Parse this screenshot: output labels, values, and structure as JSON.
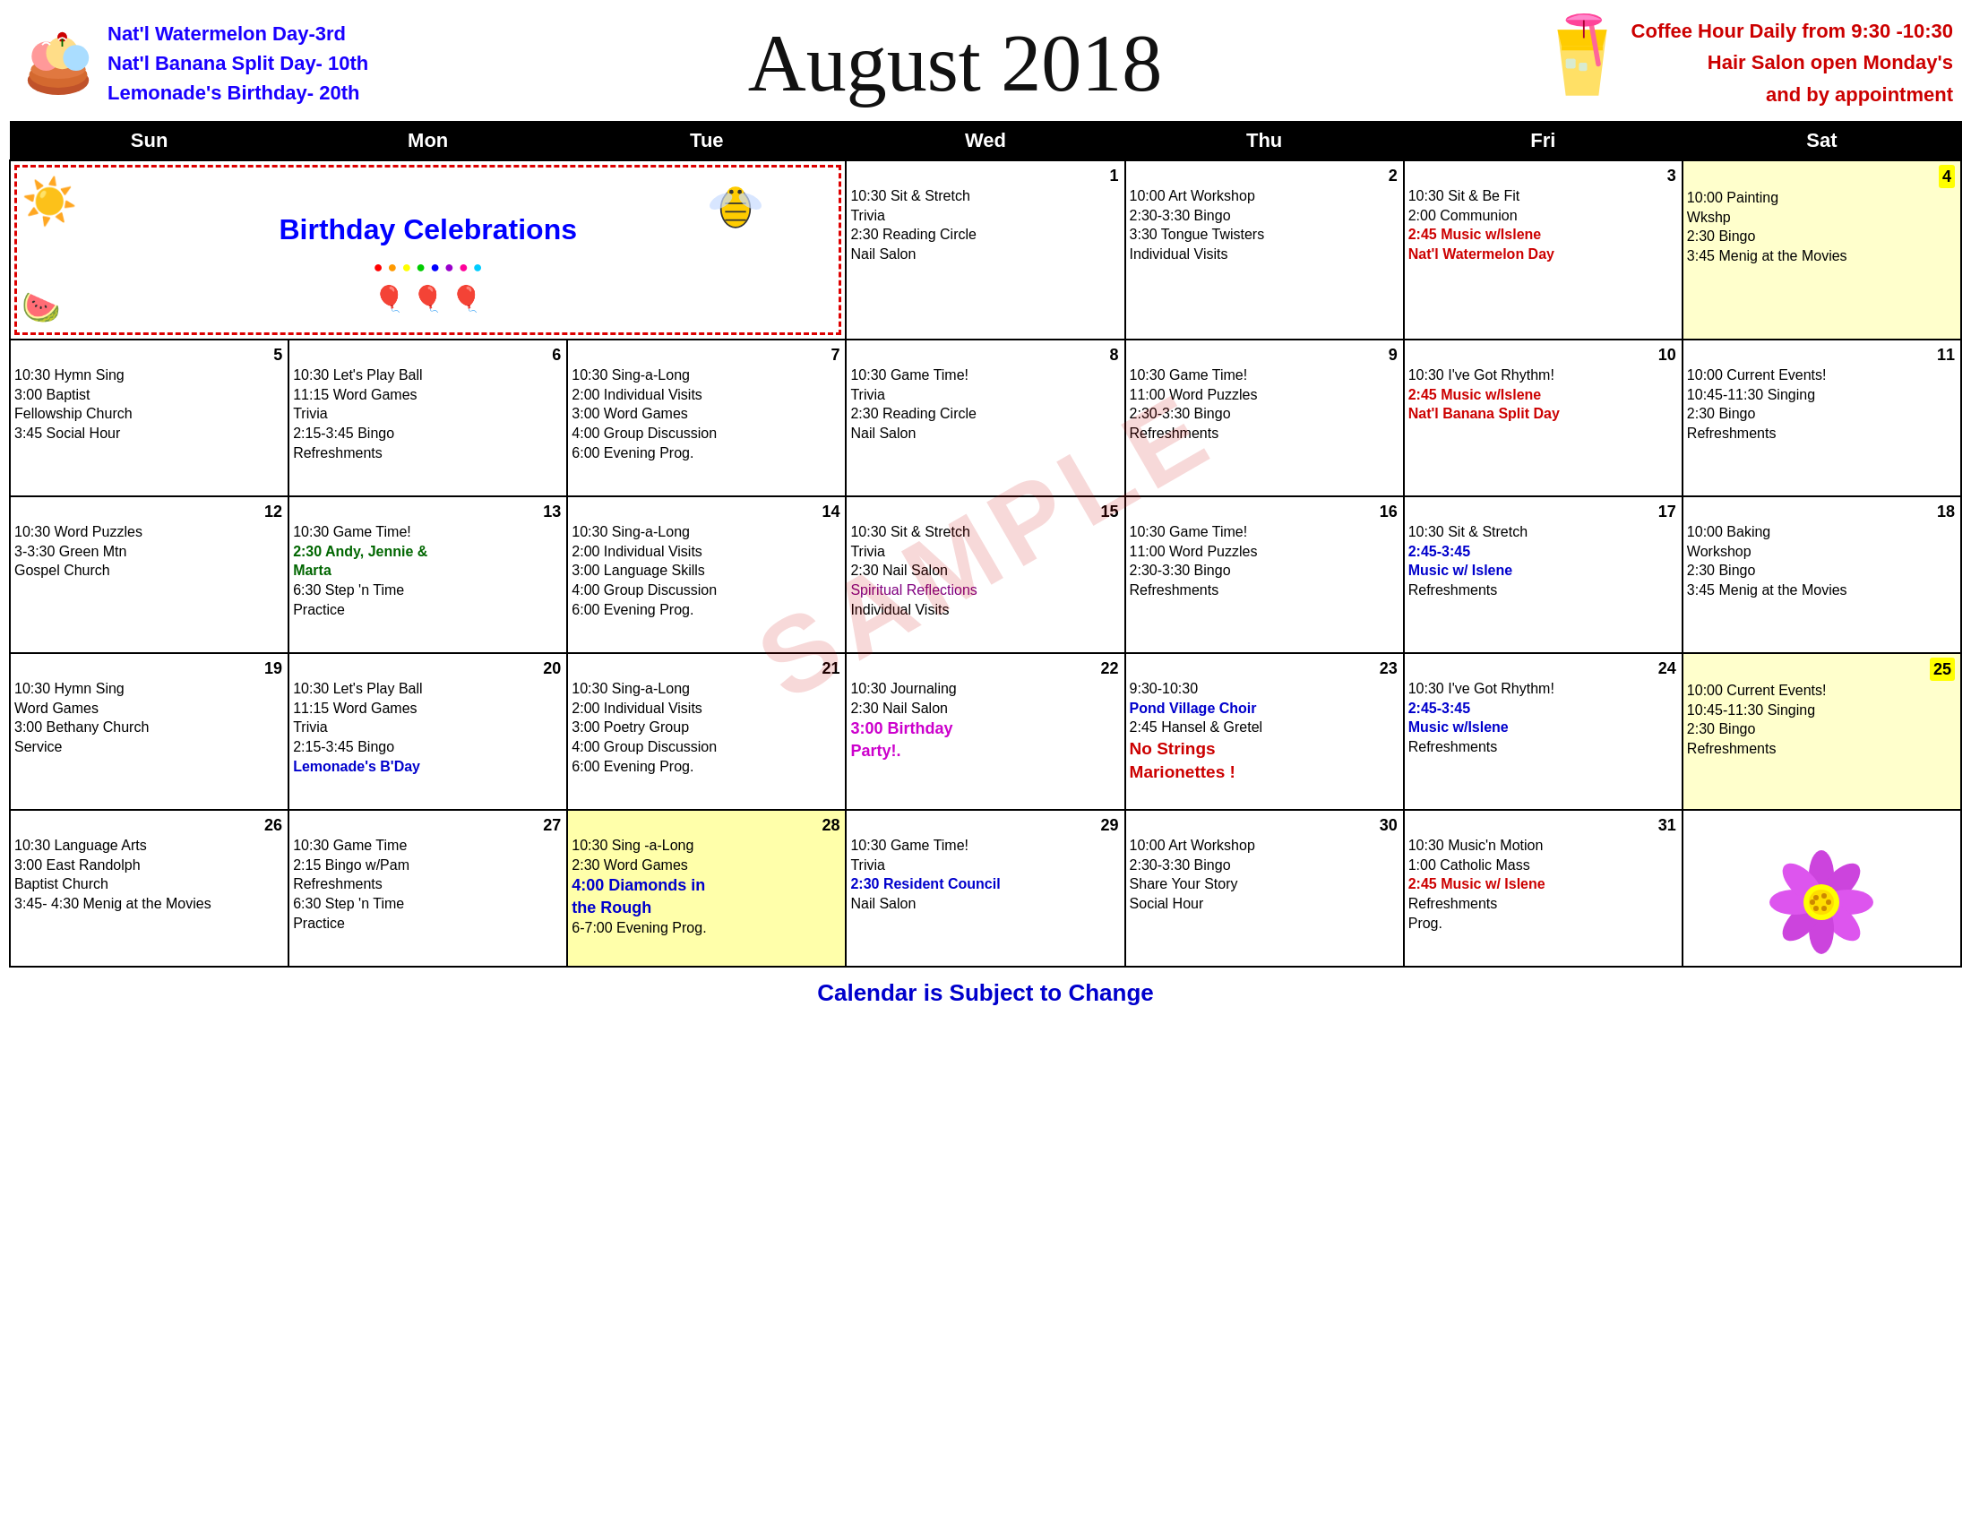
{
  "header": {
    "title": "August 2018",
    "left_notes": [
      "Nat'l Watermelon Day-3rd",
      "Nat'l Banana Split Day- 10th",
      "Lemonade's Birthday- 20th"
    ],
    "right_notes": [
      "Coffee Hour Daily from 9:30 -10:30",
      "Hair Salon open Monday's",
      "and by appointment"
    ]
  },
  "days_of_week": [
    "Sun",
    "Mon",
    "Tue",
    "Wed",
    "Thu",
    "Fri",
    "Sat"
  ],
  "footer": "Calendar is Subject to Change",
  "watermark": "SAMPLE",
  "weeks": [
    {
      "id": "week0-birthday",
      "cells": [
        {
          "span": 3,
          "type": "birthday",
          "content": "Birthday Celebrations"
        },
        {
          "day": 1,
          "events": [
            {
              "text": "10:30 Sit & Stretch",
              "color": "black"
            },
            {
              "text": "Trivia",
              "color": "black"
            },
            {
              "text": "2:30 Reading Circle",
              "color": "black"
            },
            {
              "text": "Nail Salon",
              "color": "black"
            }
          ]
        },
        {
          "day": 2,
          "events": [
            {
              "text": "10:00 Art Workshop",
              "color": "black"
            },
            {
              "text": "2:30-3:30 Bingo",
              "color": "black"
            },
            {
              "text": "3:30 Tongue Twisters",
              "color": "black"
            },
            {
              "text": "Individual Visits",
              "color": "black"
            }
          ]
        },
        {
          "day": 3,
          "events": [
            {
              "text": "10:30 Sit & Be Fit",
              "color": "black"
            },
            {
              "text": "2:00 Communion",
              "color": "black"
            },
            {
              "text": "2:45 Music w/Islene",
              "color": "red",
              "bold": true
            },
            {
              "text": "Nat'l Watermelon Day",
              "color": "red",
              "bold": true
            }
          ]
        },
        {
          "day": 4,
          "dayBg": "yellow",
          "events": [
            {
              "text": "10:00 Painting",
              "color": "black"
            },
            {
              "text": "Wkshp",
              "color": "black"
            },
            {
              "text": "2:30 Bingo",
              "color": "black"
            },
            {
              "text": "3:45 Menig at the Movies",
              "color": "black"
            }
          ]
        }
      ]
    },
    {
      "id": "week1",
      "cells": [
        {
          "day": 5,
          "events": [
            {
              "text": "10:30 Hymn Sing",
              "color": "black"
            },
            {
              "text": "3:00 Baptist",
              "color": "black"
            },
            {
              "text": "Fellowship Church",
              "color": "black"
            },
            {
              "text": "3:45 Social Hour",
              "color": "black"
            }
          ]
        },
        {
          "day": 6,
          "events": [
            {
              "text": "10:30 Let's Play Ball",
              "color": "black"
            },
            {
              "text": "11:15 Word Games",
              "color": "black"
            },
            {
              "text": "Trivia",
              "color": "black"
            },
            {
              "text": "2:15-3:45 Bingo",
              "color": "black"
            },
            {
              "text": "Refreshments",
              "color": "black"
            }
          ]
        },
        {
          "day": 7,
          "events": [
            {
              "text": "10:30 Sing-a-Long",
              "color": "black"
            },
            {
              "text": "2:00 Individual Visits",
              "color": "black"
            },
            {
              "text": "3:00 Word Games",
              "color": "black"
            },
            {
              "text": "4:00 Group Discussion",
              "color": "black"
            },
            {
              "text": "6:00 Evening Prog.",
              "color": "black"
            }
          ]
        },
        {
          "day": 8,
          "events": [
            {
              "text": "10:30 Game Time!",
              "color": "black"
            },
            {
              "text": "Trivia",
              "color": "black"
            },
            {
              "text": "2:30 Reading Circle",
              "color": "black"
            },
            {
              "text": "Nail Salon",
              "color": "black"
            }
          ]
        },
        {
          "day": 9,
          "events": [
            {
              "text": "10:30 Game Time!",
              "color": "black"
            },
            {
              "text": "11:00 Word Puzzles",
              "color": "black"
            },
            {
              "text": "2:30-3:30 Bingo",
              "color": "black"
            },
            {
              "text": "Refreshments",
              "color": "black"
            }
          ]
        },
        {
          "day": 10,
          "events": [
            {
              "text": "10:30 I've Got Rhythm!",
              "color": "black"
            },
            {
              "text": "2:45 Music w/Islene",
              "color": "red",
              "bold": true
            },
            {
              "text": "Nat'l Banana Split Day",
              "color": "red",
              "bold": true
            }
          ]
        },
        {
          "day": 11,
          "events": [
            {
              "text": "10:00 Current Events!",
              "color": "black"
            },
            {
              "text": "10:45-11:30 Singing",
              "color": "black"
            },
            {
              "text": "2:30 Bingo",
              "color": "black"
            },
            {
              "text": "Refreshments",
              "color": "black"
            }
          ]
        }
      ]
    },
    {
      "id": "week2",
      "cells": [
        {
          "day": 12,
          "events": [
            {
              "text": "10:30 Word Puzzles",
              "color": "black"
            },
            {
              "text": "3-3:30 Green Mtn",
              "color": "black"
            },
            {
              "text": "Gospel Church",
              "color": "black"
            }
          ]
        },
        {
          "day": 13,
          "events": [
            {
              "text": "10:30 Game Time!",
              "color": "black"
            },
            {
              "text": "2:30 Andy, Jennie &",
              "color": "green",
              "bold": true
            },
            {
              "text": "Marta",
              "color": "green",
              "bold": true
            },
            {
              "text": "6:30 Step 'n Time",
              "color": "black"
            },
            {
              "text": "Practice",
              "color": "black"
            }
          ]
        },
        {
          "day": 14,
          "events": [
            {
              "text": "10:30 Sing-a-Long",
              "color": "black"
            },
            {
              "text": "2:00 Individual Visits",
              "color": "black"
            },
            {
              "text": "3:00 Language Skills",
              "color": "black"
            },
            {
              "text": "4:00 Group Discussion",
              "color": "black"
            },
            {
              "text": "6:00 Evening Prog.",
              "color": "black"
            }
          ]
        },
        {
          "day": 15,
          "events": [
            {
              "text": "10:30 Sit & Stretch",
              "color": "black"
            },
            {
              "text": "Trivia",
              "color": "black"
            },
            {
              "text": "2:30 Nail Salon",
              "color": "black"
            },
            {
              "text": "Spiritual Reflections",
              "color": "purple"
            },
            {
              "text": "Individual Visits",
              "color": "black"
            }
          ]
        },
        {
          "day": 16,
          "events": [
            {
              "text": "10:30 Game Time!",
              "color": "black"
            },
            {
              "text": "11:00 Word Puzzles",
              "color": "black"
            },
            {
              "text": "2:30-3:30 Bingo",
              "color": "black"
            },
            {
              "text": "Refreshments",
              "color": "black"
            }
          ]
        },
        {
          "day": 17,
          "events": [
            {
              "text": "10:30 Sit & Stretch",
              "color": "black"
            },
            {
              "text": "2:45-3:45",
              "color": "blue",
              "bold": true
            },
            {
              "text": "Music w/ Islene",
              "color": "blue",
              "bold": true
            },
            {
              "text": "Refreshments",
              "color": "black"
            }
          ]
        },
        {
          "day": 18,
          "events": [
            {
              "text": "10:00 Baking",
              "color": "black"
            },
            {
              "text": "Workshop",
              "color": "black"
            },
            {
              "text": "2:30 Bingo",
              "color": "black"
            },
            {
              "text": "3:45 Menig at the Movies",
              "color": "black"
            }
          ]
        }
      ]
    },
    {
      "id": "week3",
      "cells": [
        {
          "day": 19,
          "events": [
            {
              "text": "10:30 Hymn Sing",
              "color": "black"
            },
            {
              "text": "Word Games",
              "color": "black"
            },
            {
              "text": "3:00 Bethany Church",
              "color": "black"
            },
            {
              "text": "Service",
              "color": "black"
            }
          ]
        },
        {
          "day": 20,
          "events": [
            {
              "text": "10:30 Let's Play Ball",
              "color": "black"
            },
            {
              "text": "11:15 Word Games",
              "color": "black"
            },
            {
              "text": "Trivia",
              "color": "black"
            },
            {
              "text": "2:15-3:45 Bingo",
              "color": "black"
            },
            {
              "text": "Lemonade's B'Day",
              "color": "blue",
              "bold": true
            }
          ]
        },
        {
          "day": 21,
          "events": [
            {
              "text": "10:30 Sing-a-Long",
              "color": "black"
            },
            {
              "text": "2:00 Individual Visits",
              "color": "black"
            },
            {
              "text": "3:00 Poetry Group",
              "color": "black"
            },
            {
              "text": "4:00 Group Discussion",
              "color": "black"
            },
            {
              "text": "6:00 Evening Prog.",
              "color": "black"
            }
          ]
        },
        {
          "day": 22,
          "events": [
            {
              "text": "10:30 Journaling",
              "color": "black"
            },
            {
              "text": "2:30 Nail Salon",
              "color": "black"
            },
            {
              "text": "3:00 Birthday",
              "color": "magenta",
              "bold": true
            },
            {
              "text": "Party!.",
              "color": "magenta",
              "bold": true
            }
          ]
        },
        {
          "day": 23,
          "events": [
            {
              "text": "9:30-10:30",
              "color": "black"
            },
            {
              "text": "Pond Village Choir",
              "color": "blue",
              "bold": true
            },
            {
              "text": "2:45 Hansel & Gretel",
              "color": "black"
            },
            {
              "text": "No Strings",
              "color": "red",
              "bold": true,
              "larger": true
            },
            {
              "text": "Marionettes !",
              "color": "red",
              "bold": true,
              "larger": true
            }
          ]
        },
        {
          "day": 24,
          "events": [
            {
              "text": "10:30 I've Got Rhythm!",
              "color": "black"
            },
            {
              "text": "2:45-3:45",
              "color": "blue",
              "bold": true
            },
            {
              "text": "Music w/Islene",
              "color": "blue",
              "bold": true
            },
            {
              "text": "Refreshments",
              "color": "black"
            }
          ]
        },
        {
          "day": 25,
          "dayBg": "yellow",
          "events": [
            {
              "text": "10:00 Current Events!",
              "color": "black"
            },
            {
              "text": "10:45-11:30 Singing",
              "color": "black"
            },
            {
              "text": "2:30 Bingo",
              "color": "black"
            },
            {
              "text": "Refreshments",
              "color": "black"
            }
          ]
        }
      ]
    },
    {
      "id": "week4",
      "cells": [
        {
          "day": 26,
          "events": [
            {
              "text": "10:30 Language Arts",
              "color": "black"
            },
            {
              "text": "3:00 East Randolph",
              "color": "black"
            },
            {
              "text": "Baptist Church",
              "color": "black"
            },
            {
              "text": "3:45- 4:30 Menig at the Movies",
              "color": "black"
            }
          ]
        },
        {
          "day": 27,
          "events": [
            {
              "text": "10:30 Game Time",
              "color": "black"
            },
            {
              "text": "2:15 Bingo w/Pam",
              "color": "black"
            },
            {
              "text": "Refreshments",
              "color": "black"
            },
            {
              "text": "6:30 Step 'n Time",
              "color": "black"
            },
            {
              "text": "Practice",
              "color": "black"
            }
          ]
        },
        {
          "day": 28,
          "events": [
            {
              "text": "10:30 Sing -a-Long",
              "color": "black"
            },
            {
              "text": "2:30 Word Games",
              "color": "black"
            },
            {
              "text": "4:00 Diamonds in",
              "color": "blue",
              "bold": true
            },
            {
              "text": "the Rough",
              "color": "blue",
              "bold": true
            },
            {
              "text": "6-7:00 Evening Prog.",
              "color": "black"
            }
          ]
        },
        {
          "day": 29,
          "events": [
            {
              "text": "10:30 Game Time!",
              "color": "black"
            },
            {
              "text": "Trivia",
              "color": "black"
            },
            {
              "text": "2:30 Resident Council",
              "color": "blue",
              "bold": true
            },
            {
              "text": "Nail Salon",
              "color": "black"
            }
          ]
        },
        {
          "day": 30,
          "events": [
            {
              "text": "10:00 Art Workshop",
              "color": "black"
            },
            {
              "text": "2:30-3:30 Bingo",
              "color": "black"
            },
            {
              "text": "Share Your Story",
              "color": "black"
            },
            {
              "text": "Social Hour",
              "color": "black"
            }
          ]
        },
        {
          "day": 31,
          "events": [
            {
              "text": "10:30 Music'n Motion",
              "color": "black"
            },
            {
              "text": "1:00 Catholic Mass",
              "color": "black"
            },
            {
              "text": "2:45 Music w/ Islene",
              "color": "red",
              "bold": true
            },
            {
              "text": "Refreshments",
              "color": "black"
            },
            {
              "text": "Prog.",
              "color": "black"
            }
          ]
        },
        {
          "day": null,
          "extra": "flower",
          "events": []
        }
      ]
    }
  ]
}
